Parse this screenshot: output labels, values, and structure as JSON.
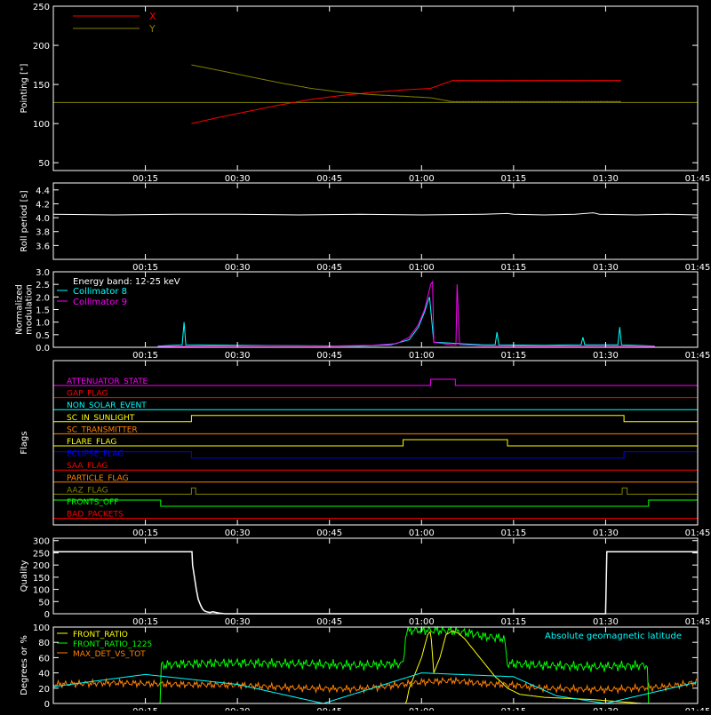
{
  "time_axis": {
    "ticks": [
      "00:15",
      "00:30",
      "00:45",
      "01:00",
      "01:15",
      "01:30",
      "01:45"
    ],
    "tick_minutes": [
      15,
      30,
      45,
      60,
      75,
      90,
      105
    ],
    "xlim_minutes": [
      0,
      105
    ]
  },
  "colors": {
    "white": "#ffffff",
    "red": "#ff0000",
    "olive": "#808000",
    "cyan": "#00ffff",
    "magenta": "#ff00ff",
    "yellow": "#ffff00",
    "green": "#00ff00",
    "orange": "#ff8000",
    "blue": "#0000ff",
    "gold": "#d0a000"
  },
  "chart_data": [
    {
      "type": "line",
      "ylabel": "Pointing [\"]",
      "ylim": [
        40,
        250
      ],
      "yticks": [
        50,
        100,
        150,
        200,
        250
      ],
      "baseline_y": 127,
      "legend_placement": "top-left",
      "series": [
        {
          "name": "X",
          "color": "#ff0000",
          "x": [
            22.5,
            27,
            32,
            37,
            42,
            47,
            52,
            57,
            61.5,
            65,
            70,
            75,
            80,
            85,
            90,
            92.5
          ],
          "y": [
            100,
            108,
            116,
            124,
            131,
            136,
            140,
            143,
            145,
            155,
            155,
            155,
            155,
            155,
            155,
            155
          ],
          "amplitude": [
            45,
            38,
            30,
            22,
            14,
            8,
            4,
            3,
            2,
            20,
            18,
            16,
            15,
            14,
            14,
            14
          ]
        },
        {
          "name": "Y",
          "color": "#808000",
          "x": [
            22.5,
            27,
            32,
            37,
            42,
            47,
            52,
            57,
            61.5,
            65,
            70,
            75,
            80,
            85,
            90,
            92.5
          ],
          "y": [
            175,
            168,
            160,
            152,
            145,
            140,
            137,
            135,
            133,
            128,
            128,
            128,
            128,
            128,
            128,
            128
          ],
          "amplitude": [
            38,
            32,
            27,
            22,
            17,
            13,
            10,
            8,
            7,
            22,
            20,
            18,
            16,
            15,
            15,
            15
          ]
        }
      ]
    },
    {
      "type": "line",
      "ylabel": "Roll period [s]",
      "ylim": [
        3.4,
        4.5
      ],
      "yticks": [
        3.6,
        3.8,
        4.0,
        4.2,
        4.4
      ],
      "series": [
        {
          "name": "",
          "color": "#ffffff",
          "x": [
            0,
            10,
            20,
            30,
            40,
            50,
            60,
            70,
            74,
            75,
            80,
            85,
            88,
            89,
            95,
            100,
            105
          ],
          "y": [
            4.05,
            4.04,
            4.05,
            4.05,
            4.04,
            4.05,
            4.04,
            4.05,
            4.06,
            4.05,
            4.04,
            4.05,
            4.07,
            4.05,
            4.04,
            4.05,
            4.04
          ]
        }
      ]
    },
    {
      "type": "line",
      "ylabel": "Normalized modulation",
      "ylim": [
        0,
        3
      ],
      "yticks": [
        0.0,
        0.5,
        1.0,
        1.5,
        2.0,
        2.5,
        3.0
      ],
      "legend_placement": "top-left",
      "title": "Energy band: 12-25 keV",
      "series": [
        {
          "name": "Collimator 8",
          "color": "#00ffff",
          "x": [
            17,
            21,
            21.3,
            21.6,
            30,
            40,
            50,
            55,
            58,
            59.5,
            60.5,
            61,
            61.3,
            62,
            70,
            72,
            72.3,
            72.6,
            80,
            86,
            86.3,
            86.6,
            92,
            92.3,
            92.6,
            98
          ],
          "y": [
            0.05,
            0.1,
            1.0,
            0.1,
            0.08,
            0.06,
            0.05,
            0.1,
            0.3,
            0.8,
            1.4,
            1.8,
            2.0,
            0.2,
            0.1,
            0.1,
            0.6,
            0.1,
            0.08,
            0.1,
            0.4,
            0.1,
            0.1,
            0.8,
            0.1,
            0.05
          ]
        },
        {
          "name": "Collimator 9",
          "color": "#ff00ff",
          "x": [
            17,
            25,
            35,
            45,
            52,
            56,
            58,
            59.5,
            60.5,
            61,
            61.5,
            61.8,
            62,
            65,
            65.6,
            65.8,
            66.2,
            70,
            80,
            90,
            98
          ],
          "y": [
            0.03,
            0.05,
            0.06,
            0.05,
            0.08,
            0.15,
            0.4,
            0.9,
            1.5,
            2.0,
            2.5,
            2.6,
            0.2,
            0.1,
            0.1,
            2.5,
            0.1,
            0.06,
            0.05,
            0.06,
            0.04
          ]
        }
      ]
    },
    {
      "type": "line",
      "ylabel": "Flags",
      "series": [
        {
          "name": "ATTENUATOR_STATE",
          "color": "#ff00ff",
          "on": [
            [
              61.5,
              65.5
            ]
          ]
        },
        {
          "name": "GAP_FLAG",
          "color": "#ff0000",
          "on": []
        },
        {
          "name": "NON_SOLAR_EVENT",
          "color": "#00ffff",
          "on": []
        },
        {
          "name": "SC_IN_SUNLIGHT",
          "color": "#ffff00",
          "on": [
            [
              22.5,
              93
            ]
          ]
        },
        {
          "name": "SC_TRANSMITTER",
          "color": "#ff8000",
          "on": []
        },
        {
          "name": "FLARE_FLAG",
          "color": "#ffff00",
          "on": [
            [
              57,
              74
            ]
          ]
        },
        {
          "name": "ECLIPSE_FLAG",
          "color": "#0000ff",
          "on": [
            [
              0,
              22.5
            ],
            [
              93,
              105
            ]
          ]
        },
        {
          "name": "SAA_FLAG",
          "color": "#ff0000",
          "on": []
        },
        {
          "name": "PARTICLE_FLAG",
          "color": "#ff8000",
          "on": []
        },
        {
          "name": "AAZ_FLAG",
          "color": "#808000",
          "on": [
            [
              22.5,
              23.2
            ],
            [
              92.7,
              93.5
            ]
          ]
        },
        {
          "name": "FRONTS_OFF",
          "color": "#00ff00",
          "on": [
            [
              0,
              17.5
            ],
            [
              97,
              105
            ]
          ]
        },
        {
          "name": "BAD_PACKETS",
          "color": "#ff0000",
          "on": []
        }
      ]
    },
    {
      "type": "line",
      "ylabel": "Quality",
      "ylim": [
        0,
        310
      ],
      "yticks": [
        0,
        50,
        100,
        150,
        200,
        250,
        300
      ],
      "series": [
        {
          "name": "",
          "color": "#ffffff",
          "x": [
            0,
            22.6,
            22.7,
            23,
            23.3,
            23.6,
            24,
            24.3,
            24.6,
            25,
            25.5,
            26,
            27,
            28,
            90,
            90.2,
            105
          ],
          "y": [
            255,
            255,
            200,
            150,
            100,
            60,
            35,
            20,
            12,
            8,
            5,
            8,
            3,
            0,
            0,
            255,
            255
          ]
        }
      ]
    },
    {
      "type": "line",
      "ylabel": "Degrees or %",
      "ylim": [
        0,
        100
      ],
      "yticks": [
        0,
        20,
        40,
        60,
        80,
        100
      ],
      "legend_placement": "top-left",
      "annotation": "Absolute geomagnetic latitude",
      "series": [
        {
          "name": "FRONT_RATIO",
          "color": "#ffff00",
          "x": [
            0,
            17.5,
            25,
            35,
            45,
            55,
            57.5,
            58,
            59,
            60,
            61,
            61.5,
            62,
            63,
            64,
            65,
            66,
            67,
            68,
            69,
            70,
            71,
            72,
            73,
            74,
            76,
            80,
            88,
            96
          ],
          "y": [
            0,
            0,
            0,
            0,
            0,
            0,
            0,
            20,
            40,
            60,
            90,
            95,
            40,
            60,
            90,
            95,
            92,
            85,
            75,
            65,
            55,
            45,
            35,
            28,
            20,
            12,
            8,
            5,
            0
          ]
        },
        {
          "name": "FRONT_RATIO_1225",
          "color": "#00ff00",
          "x": [
            0,
            17.5,
            17.6,
            22,
            30,
            40,
            50,
            57,
            57.5,
            60,
            65,
            68,
            70,
            73.5,
            74,
            80,
            88,
            96.9,
            97,
            105
          ],
          "y": [
            0,
            0,
            50,
            52,
            53,
            52,
            50,
            52,
            95,
            96,
            95,
            92,
            88,
            85,
            52,
            50,
            48,
            50,
            0,
            0
          ]
        },
        {
          "name": "MAX_DET_VS_TOT",
          "color": "#ff8000",
          "x": [
            0,
            10,
            20,
            30,
            40,
            50,
            55,
            60,
            65,
            70,
            75,
            80,
            90,
            100,
            105
          ],
          "y": [
            25,
            27,
            25,
            24,
            20,
            19,
            23,
            28,
            30,
            26,
            24,
            20,
            18,
            22,
            28
          ]
        },
        {
          "name": "Absolute geomagnetic latitude",
          "color": "#00ffff",
          "x": [
            0,
            15,
            30,
            44,
            60,
            75,
            82,
            90,
            98,
            105
          ],
          "y": [
            22,
            38,
            25,
            0,
            40,
            35,
            10,
            0,
            15,
            28
          ]
        }
      ]
    }
  ]
}
